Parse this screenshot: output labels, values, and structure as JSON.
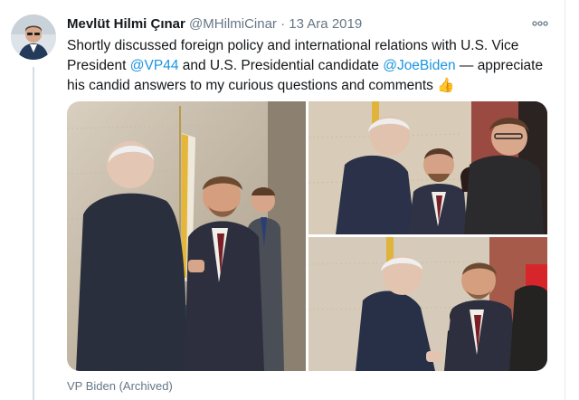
{
  "tweet": {
    "author_name": "Mevlüt Hilmi Çınar",
    "handle": "@MHilmiCinar",
    "separator": "·",
    "date": "13 Ara 2019",
    "more_icon": "more-horizontal-icon",
    "text_parts": [
      "Shortly discussed foreign policy and international relations with U.S. Vice President ",
      "@VP44",
      " and U.S. Presidential candidate ",
      "@JoeBiden",
      " — appreciate his candid answers to my curious questions and comments ",
      "👍"
    ],
    "source": "VP Biden (Archived)"
  },
  "colors": {
    "link": "#1b95e0",
    "secondary_text": "#657786",
    "thread_line": "#d7dde2"
  },
  "media": {
    "photos": [
      "photo-handshake",
      "photo-conversation",
      "photo-greeting"
    ]
  }
}
